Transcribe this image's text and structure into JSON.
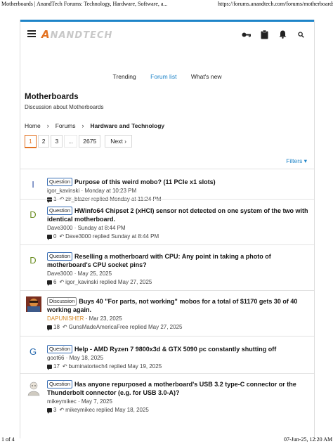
{
  "print": {
    "title": "Motherboards | AnandTech Forums: Technology, Hardware, Software, a...",
    "url": "https://forums.anandtech.com/forums/motherboards.6",
    "page": "1 of 4",
    "date": "07-Jun-25, 12:20 AM"
  },
  "header": {
    "logo_text": "ANANDTECH",
    "icons": [
      "hamburger-icon",
      "key-icon",
      "clipboard-icon",
      "bell-icon",
      "search-icon"
    ]
  },
  "tabs": [
    {
      "label": "Trending",
      "active": false
    },
    {
      "label": "Forum list",
      "active": true
    },
    {
      "label": "What's new",
      "active": false
    }
  ],
  "forum": {
    "title": "Motherboards",
    "description": "Discussion about Motherboards"
  },
  "breadcrumb": [
    "Home",
    "Forums",
    "Hardware and Technology"
  ],
  "pagination": {
    "pages": [
      "1",
      "2",
      "3",
      "...",
      "2675"
    ],
    "current": "1",
    "next_label": "Next"
  },
  "filters_label": "Filters",
  "threads": [
    {
      "avatar_letter": "I",
      "avatar_color": "#3b5ba8",
      "prefix": "Question",
      "title": "Purpose of this weird mobo? (11 PCIe x1 slots)",
      "author": "igor_kavinski",
      "date": "Monday at 10:23 PM",
      "replies": "1",
      "last_reply": "zir_blazer replied Monday at 11:24 PM"
    },
    {
      "avatar_letter": "D",
      "avatar_color": "#6b8e23",
      "prefix": "Question",
      "title": "HWinfo64 Chipset 2 (xHCI) sensor not detected on one system of the two with identical motherboard.",
      "author": "Dave3000",
      "date": "Sunday at 8:44 PM",
      "replies": "0",
      "last_reply": "Dave3000 replied Sunday at 8:44 PM"
    },
    {
      "avatar_letter": "D",
      "avatar_color": "#6b8e23",
      "prefix": "Question",
      "title": "Reselling a motherboard with CPU: Any point in taking a photo of motherboard's CPU socket pins?",
      "author": "Dave3000",
      "date": "May 25, 2025",
      "replies": "6",
      "last_reply": "igor_kavinski replied May 27, 2025"
    },
    {
      "avatar_letter": "",
      "avatar_color": "#b0413e",
      "prefix": "Discussion",
      "title": "Buys 40 \"For parts, not working\" mobos for a total of $1170 gets 30 of 40 working again.",
      "author": "DAPUNISHER",
      "date": "Mar 23, 2025",
      "replies": "18",
      "last_reply": "GunsMadeAmericaFree replied May 27, 2025"
    },
    {
      "avatar_letter": "G",
      "avatar_color": "#2b6cb0",
      "prefix": "Question",
      "title": "Help - AMD Ryzen 7 9800x3d & GTX 5090 pc constantly shutting off",
      "author": "goot66",
      "date": "May 18, 2025",
      "replies": "17",
      "last_reply": "burninatortech4 replied May 19, 2025"
    },
    {
      "avatar_letter": "",
      "avatar_color": "#999999",
      "prefix": "Question",
      "title": "Has anyone repurposed a motherboard's USB 3.2 type-C connector or the Thunderbolt connector (e.g. for USB 3.0-A)?",
      "author": "mikeymikec",
      "date": "May 7, 2025",
      "replies": "3",
      "last_reply": "mikeymikec replied May 18, 2025"
    }
  ],
  "colors": {
    "accent": "#1e84c8",
    "logo_orange": "#e37222",
    "author_highlight": "#d48a2a"
  }
}
